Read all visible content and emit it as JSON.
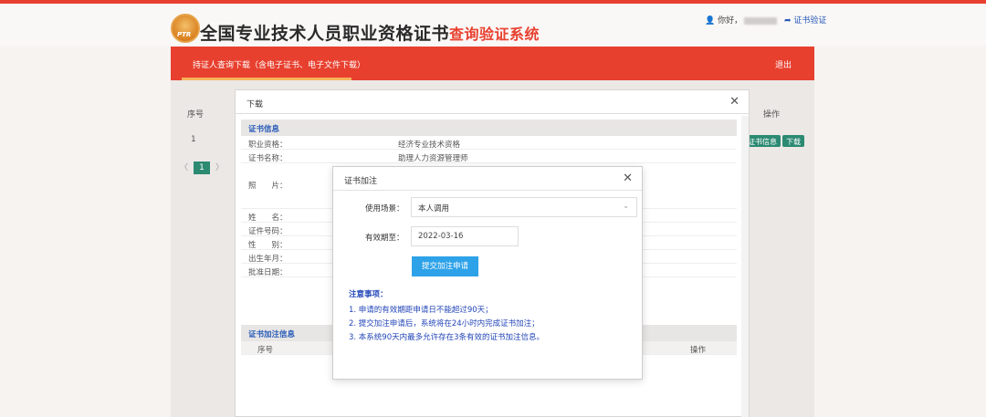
{
  "header": {
    "logo_text": "PTR",
    "title_main": "全国专业技术人员职业资格证书",
    "title_red": "查询验证系统",
    "greeting": "你好，",
    "verify_link": "证书验证"
  },
  "nav": {
    "tab_label": "持证人查询下载（含电子证书、电子文件下载）",
    "exit_label": "退出"
  },
  "background_table": {
    "col_seq": "序号",
    "col_op": "操作",
    "row_seq": "1",
    "btn_info": "证书信息",
    "btn_download": "下载",
    "pager_prev": "〈",
    "pager_current": "1",
    "pager_next": "〉"
  },
  "download_dialog": {
    "title": "下载",
    "section_cert": "证书信息",
    "rows": [
      {
        "label": "职业资格：",
        "value": "经济专业技术资格"
      },
      {
        "label": "证书名称：",
        "value": "助理人力资源管理师"
      },
      {
        "label": "照　　片：",
        "value": ""
      },
      {
        "label": "姓　　名：",
        "value": ""
      },
      {
        "label": "证件号码：",
        "value": ""
      },
      {
        "label": "性　　别：",
        "value": ""
      },
      {
        "label": "出生年月：",
        "value": ""
      },
      {
        "label": "批准日期：",
        "value": ""
      }
    ],
    "section_annot": "证书加注信息",
    "annot_col_seq": "序号",
    "annot_col_op": "操作"
  },
  "annot_dialog": {
    "title": "证书加注",
    "scene_label": "使用场景：",
    "scene_value": "本人调用",
    "expire_label": "有效期至：",
    "expire_value": "2022-03-16",
    "submit_label": "提交加注申请",
    "notes_title": "注意事项：",
    "notes": [
      "1. 申请的有效期距申请日不能超过90天；",
      "2. 提交加注申请后，系统将在24小时内完成证书加注；",
      "3. 本系统90天内最多允许存在3条有效的证书加注信息。"
    ]
  }
}
